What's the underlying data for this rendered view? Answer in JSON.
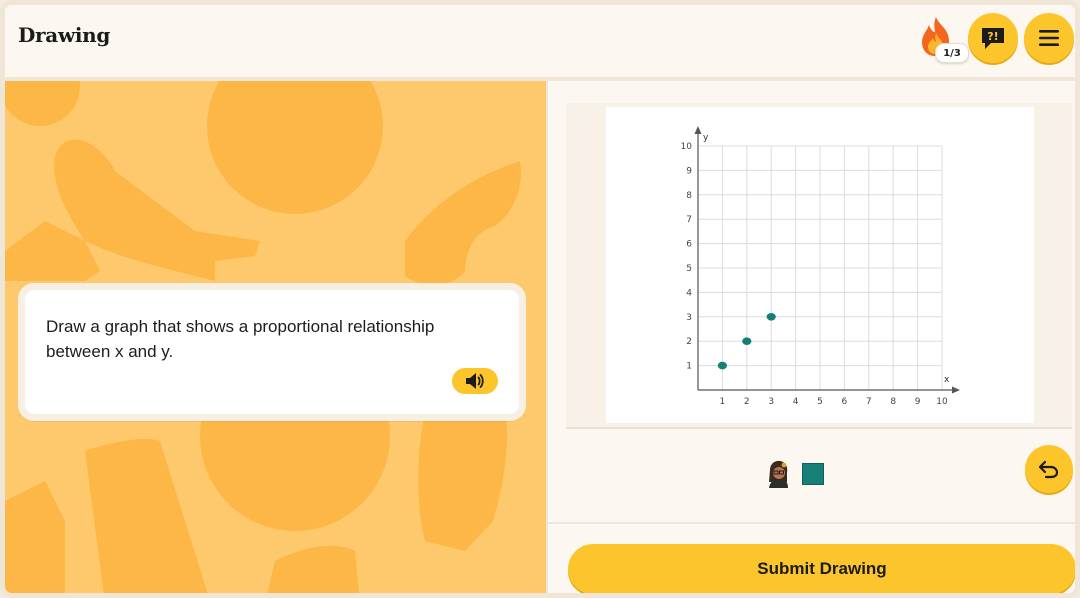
{
  "header": {
    "title": "Drawing",
    "streak_label": "1/3"
  },
  "prompt": {
    "text": "Draw a graph that shows a proportional relationship between x and y."
  },
  "graph": {
    "x_axis_label": "x",
    "y_axis_label": "y",
    "x_ticks": [
      "1",
      "2",
      "3",
      "4",
      "5",
      "6",
      "7",
      "8",
      "9",
      "10"
    ],
    "y_ticks": [
      "1",
      "2",
      "3",
      "4",
      "5",
      "6",
      "7",
      "8",
      "9",
      "10"
    ],
    "drawn_points": [
      [
        1,
        1
      ],
      [
        2,
        2
      ],
      [
        3,
        3
      ]
    ],
    "point_color": "#168077"
  },
  "toolbar": {
    "selected_color": "#168077"
  },
  "submit": {
    "label": "Submit Drawing"
  },
  "colors": {
    "accent": "#fdc52c",
    "background_pattern": "#fdc96c"
  }
}
